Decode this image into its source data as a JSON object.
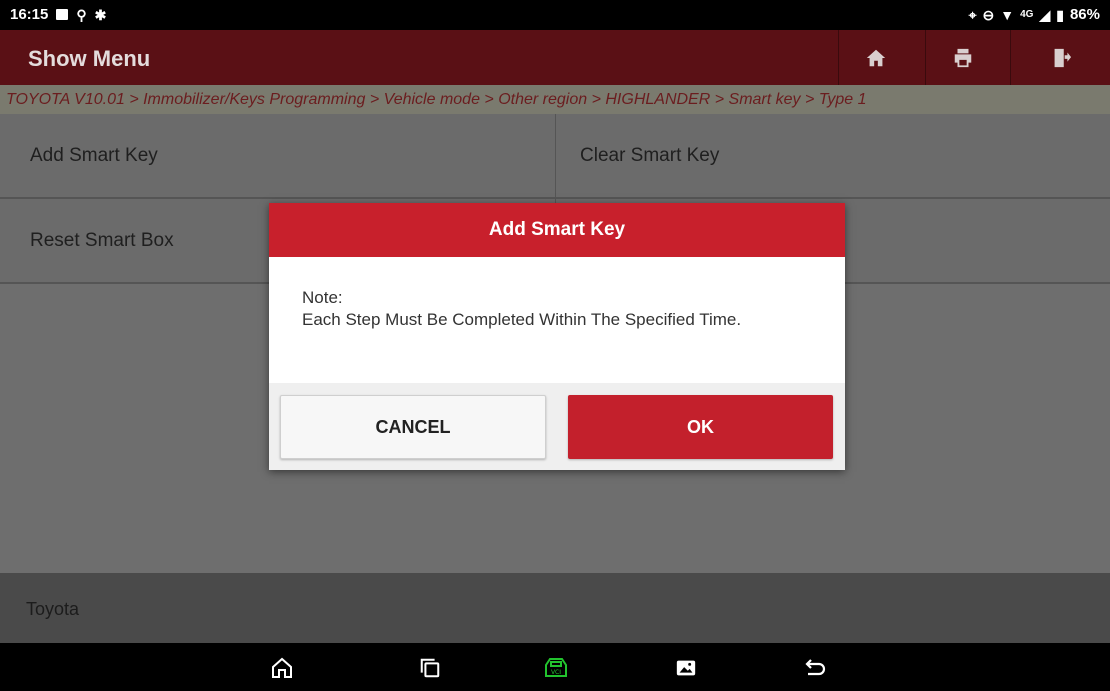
{
  "status_bar": {
    "time": "16:15",
    "battery": "86%",
    "network": "4G"
  },
  "header": {
    "title": "Show Menu"
  },
  "breadcrumb": "TOYOTA V10.01 > Immobilizer/Keys Programming > Vehicle mode > Other region > HIGHLANDER > Smart key > Type 1",
  "menu": {
    "items": [
      {
        "label": "Add Smart Key"
      },
      {
        "label": "Clear Smart Key"
      },
      {
        "label": "Reset Smart Box"
      },
      {
        "label": ""
      }
    ]
  },
  "footer": {
    "label": "Toyota"
  },
  "dialog": {
    "title": "Add Smart Key",
    "note_label": "Note:",
    "message": "Each Step Must Be Completed Within The Specified Time.",
    "cancel_label": "CANCEL",
    "ok_label": "OK"
  },
  "colors": {
    "accent": "#c8202c",
    "vci_icon": "#22c32e"
  },
  "icons": {
    "header": [
      "home-icon",
      "print-icon",
      "exit-icon"
    ],
    "nav": [
      "nav-home-icon",
      "recent-apps-icon",
      "vci-icon",
      "gallery-icon",
      "back-icon"
    ]
  }
}
